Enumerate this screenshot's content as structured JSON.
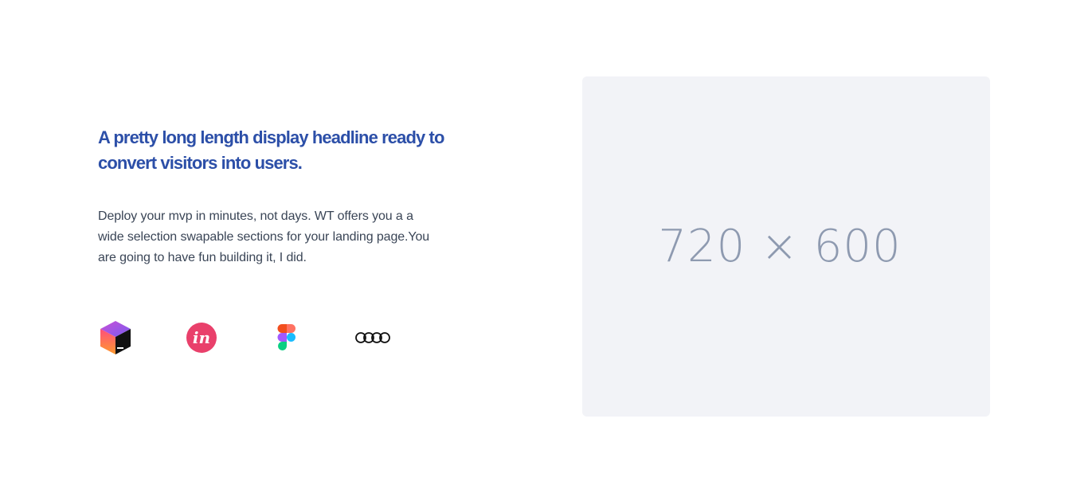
{
  "hero": {
    "headline": "A pretty long length display headline ready to convert visitors into users.",
    "description": "Deploy your mvp in minutes, not days. WT offers you a a wide selection swapable sections for your landing page.You are going to have fun building it, I did."
  },
  "logos": [
    {
      "name": "jetbrains-icon"
    },
    {
      "name": "invision-icon"
    },
    {
      "name": "figma-icon"
    },
    {
      "name": "audi-icon"
    }
  ],
  "image_placeholder": {
    "label": "720 × 600"
  },
  "colors": {
    "headline": "#2c4fa8",
    "body_text": "#3a4556",
    "placeholder_bg": "#f2f3f7",
    "placeholder_text": "#8e9ab0"
  }
}
